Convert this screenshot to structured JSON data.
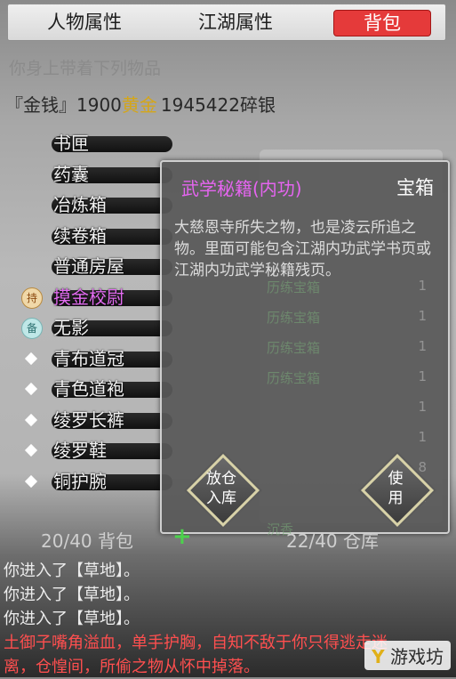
{
  "tabs": [
    {
      "label": "人物属性",
      "active": false
    },
    {
      "label": "江湖属性",
      "active": false
    },
    {
      "label": "背包",
      "active": true
    }
  ],
  "inventory_caption": "你身上带着下列物品",
  "money": {
    "prefix": "『金钱』1900",
    "gold_word": "黄金",
    "silver": "1945422碎银"
  },
  "items": [
    {
      "label": "书匣",
      "mark": "",
      "purple": false
    },
    {
      "label": "药囊",
      "mark": "",
      "purple": false
    },
    {
      "label": "冶炼箱",
      "mark": "",
      "purple": false
    },
    {
      "label": "续卷箱",
      "mark": "",
      "purple": false
    },
    {
      "label": "普通房屋",
      "mark": "",
      "purple": false
    },
    {
      "label": "摸金校尉",
      "mark": "special",
      "purple": true
    },
    {
      "label": "无影",
      "mark": "backup",
      "purple": false
    },
    {
      "label": "青布道冠",
      "mark": "diamond",
      "purple": false
    },
    {
      "label": "青色道袍",
      "mark": "diamond",
      "purple": false
    },
    {
      "label": "绫罗长裤",
      "mark": "diamond",
      "purple": false
    },
    {
      "label": "绫罗鞋",
      "mark": "diamond",
      "purple": false
    },
    {
      "label": "铜护腕",
      "mark": "diamond",
      "purple": false
    }
  ],
  "item_marks": {
    "special": "持",
    "backup": "备"
  },
  "popup": {
    "title": "武学秘籍(内功)",
    "kind": "宝箱",
    "description": "大慈恩寺所失之物，也是凌云所追之物。里面可能包含江湖内功武学书页或江湖内功武学秘籍残页。",
    "left_button": "放仓\n入库",
    "right_button": "使\n用"
  },
  "ghost_rows": [
    {
      "name": "历练宝箱",
      "count": "1"
    },
    {
      "name": "历练宝箱",
      "count": "1"
    },
    {
      "name": "历练宝箱",
      "count": "1"
    },
    {
      "name": "历练宝箱",
      "count": "1"
    },
    {
      "name": "",
      "count": "1"
    },
    {
      "name": "",
      "count": "1"
    },
    {
      "name": "",
      "count": "8"
    },
    {
      "name": "",
      "count": "1"
    },
    {
      "name": "沉香",
      "count": ""
    }
  ],
  "bag_count": "20/40 背包",
  "warehouse_count": "22/40 仓库",
  "log": [
    {
      "text": "你进入了【草地】。",
      "warn": false
    },
    {
      "text": "你进入了【草地】。",
      "warn": false
    },
    {
      "text": "你进入了【草地】。",
      "warn": false
    },
    {
      "text": "土御子嘴角溢血，单手护胸，自知不敌于你只得逃走迷",
      "warn": true
    },
    {
      "text": "离，仓惶间，所偷之物从怀中掉落。",
      "warn": true
    }
  ],
  "watermark": "游戏坊"
}
